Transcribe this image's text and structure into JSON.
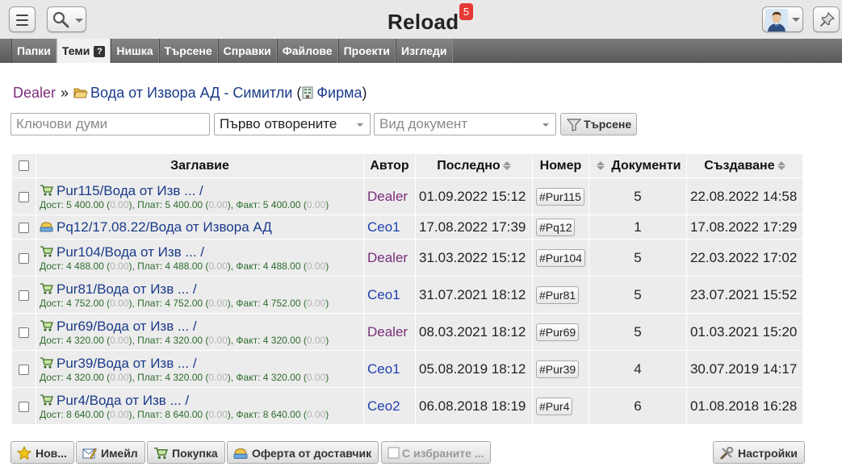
{
  "app": {
    "title": "Reload",
    "notification_count": "5"
  },
  "tabs": [
    {
      "label": "Папки"
    },
    {
      "label": "Теми",
      "help": "?"
    },
    {
      "label": "Нишка"
    },
    {
      "label": "Търсене"
    },
    {
      "label": "Справки"
    },
    {
      "label": "Файлове"
    },
    {
      "label": "Проекти"
    },
    {
      "label": "Изгледи"
    }
  ],
  "breadcrumb": {
    "user": "Dealer",
    "sep": "»",
    "folder": "Вода от Извора АД - Симитли",
    "open_paren": "(",
    "firm": "Фирма",
    "close_paren": ")"
  },
  "filters": {
    "keywords_placeholder": "Ключови думи",
    "sort_value": "Първо отворените",
    "doc_type_placeholder": "Вид документ",
    "search_label": "Търсене"
  },
  "table": {
    "headers": {
      "title": "Заглавие",
      "author": "Автор",
      "last": "Последно",
      "number": "Номер",
      "docs": "Документи",
      "created": "Създаване"
    },
    "rows": [
      {
        "title": "Pur115/Вода от Изв ... /",
        "amounts": {
          "d": "Дост: 5 400.00 (",
          "d0": "0.00",
          "p": "), Плат: 5 400.00 (",
          "p0": "0.00",
          "f": "), Факт: 5 400.00 (",
          "f0": "0.00",
          "end": ")"
        },
        "author": "Dealer",
        "last": "01.09.2022 15:12",
        "number": "#Pur115",
        "docs": "5",
        "created": "22.08.2022 14:58"
      },
      {
        "title": "Pq12/17.08.22/Вода от Извора АД",
        "author": "Ceo1",
        "last": "17.08.2022 17:39",
        "number": "#Pq12",
        "docs": "1",
        "created": "17.08.2022 17:29"
      },
      {
        "title": "Pur104/Вода от Изв ... /",
        "amounts": {
          "d": "Дост: 4 488.00 (",
          "d0": "0.00",
          "p": "), Плат: 4 488.00 (",
          "p0": "0.00",
          "f": "), Факт: 4 488.00 (",
          "f0": "0.00",
          "end": ")"
        },
        "author": "Dealer",
        "last": "31.03.2022 15:12",
        "number": "#Pur104",
        "docs": "5",
        "created": "22.03.2022 17:02"
      },
      {
        "title": "Pur81/Вода от Изв ... /",
        "amounts": {
          "d": "Дост: 4 752.00 (",
          "d0": "0.00",
          "p": "), Плат: 4 752.00 (",
          "p0": "0.00",
          "f": "), Факт: 4 752.00 (",
          "f0": "0.00",
          "end": ")"
        },
        "author": "Ceo1",
        "last": "31.07.2021 18:12",
        "number": "#Pur81",
        "docs": "5",
        "created": "23.07.2021 15:52"
      },
      {
        "title": "Pur69/Вода от Изв ... /",
        "amounts": {
          "d": "Дост: 4 320.00 (",
          "d0": "0.00",
          "p": "), Плат: 4 320.00 (",
          "p0": "0.00",
          "f": "), Факт: 4 320.00 (",
          "f0": "0.00",
          "end": ")"
        },
        "author": "Dealer",
        "last": "08.03.2021 18:12",
        "number": "#Pur69",
        "docs": "5",
        "created": "01.03.2021 15:20"
      },
      {
        "title": "Pur39/Вода от Изв ... /",
        "amounts": {
          "d": "Дост: 4 320.00 (",
          "d0": "0.00",
          "p": "), Плат: 4 320.00 (",
          "p0": "0.00",
          "f": "), Факт: 4 320.00 (",
          "f0": "0.00",
          "end": ")"
        },
        "author": "Ceo1",
        "last": "05.08.2019 18:12",
        "number": "#Pur39",
        "docs": "4",
        "created": "30.07.2019 14:17"
      },
      {
        "title": "Pur4/Вода от Изв ... /",
        "amounts": {
          "d": "Дост: 8 640.00 (",
          "d0": "0.00",
          "p": "), Плат: 8 640.00 (",
          "p0": "0.00",
          "f": "), Факт: 8 640.00 (",
          "f0": "0.00",
          "end": ")"
        },
        "author": "Ceo2",
        "last": "06.08.2018 18:19",
        "number": "#Pur4",
        "docs": "6",
        "created": "01.08.2018 16:28"
      }
    ]
  },
  "actions": {
    "new": "Нов...",
    "email": "Имейл",
    "purchase": "Покупка",
    "offer": "Оферта от доставчик",
    "selected": "С избраните ...",
    "settings": "Настройки"
  },
  "colors": {
    "author_dealer": "#7a2d7a",
    "author_ceo": "#1f3fb0",
    "link": "#1a3b8a",
    "amounts": "#2d6b2d",
    "notification": "#e53935"
  }
}
